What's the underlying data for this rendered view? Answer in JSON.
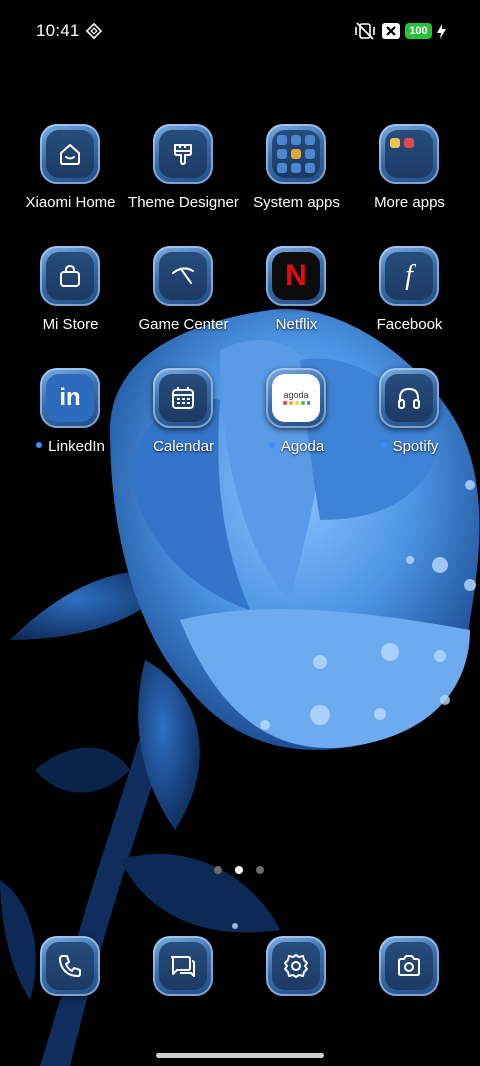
{
  "status_bar": {
    "time": "10:41",
    "battery_level": "100"
  },
  "apps": [
    {
      "label": "Xiaomi Home",
      "icon": "house-icon",
      "badge": false
    },
    {
      "label": "Theme Designer",
      "icon": "paintbrush-icon",
      "badge": false
    },
    {
      "label": "System apps",
      "icon": "folder-icon",
      "badge": false
    },
    {
      "label": "More apps",
      "icon": "folder-icon",
      "badge": false
    },
    {
      "label": "Mi Store",
      "icon": "shopping-bag-icon",
      "badge": false
    },
    {
      "label": "Game Center",
      "icon": "game-center-icon",
      "badge": false
    },
    {
      "label": "Netflix",
      "icon": "netflix-icon",
      "badge": false
    },
    {
      "label": "Facebook",
      "icon": "facebook-icon",
      "badge": false
    },
    {
      "label": "LinkedIn",
      "icon": "linkedin-icon",
      "badge": true
    },
    {
      "label": "Calendar",
      "icon": "calendar-icon",
      "badge": false
    },
    {
      "label": "Agoda",
      "icon": "agoda-icon",
      "badge": true
    },
    {
      "label": "Spotify",
      "icon": "headphones-icon",
      "badge": true
    }
  ],
  "netflix_glyph": "N",
  "facebook_glyph": "f",
  "linkedin_glyph": "in",
  "agoda_logo_text": "agoda",
  "dock": [
    {
      "name": "phone",
      "icon": "phone-icon"
    },
    {
      "name": "messages",
      "icon": "message-icon"
    },
    {
      "name": "settings",
      "icon": "gear-icon"
    },
    {
      "name": "camera",
      "icon": "camera-icon"
    }
  ],
  "pager": {
    "pages": 3,
    "current": 2
  },
  "colors": {
    "accent": "#3d8bff",
    "battery": "#27c23a",
    "tile": "#3a6fad"
  }
}
